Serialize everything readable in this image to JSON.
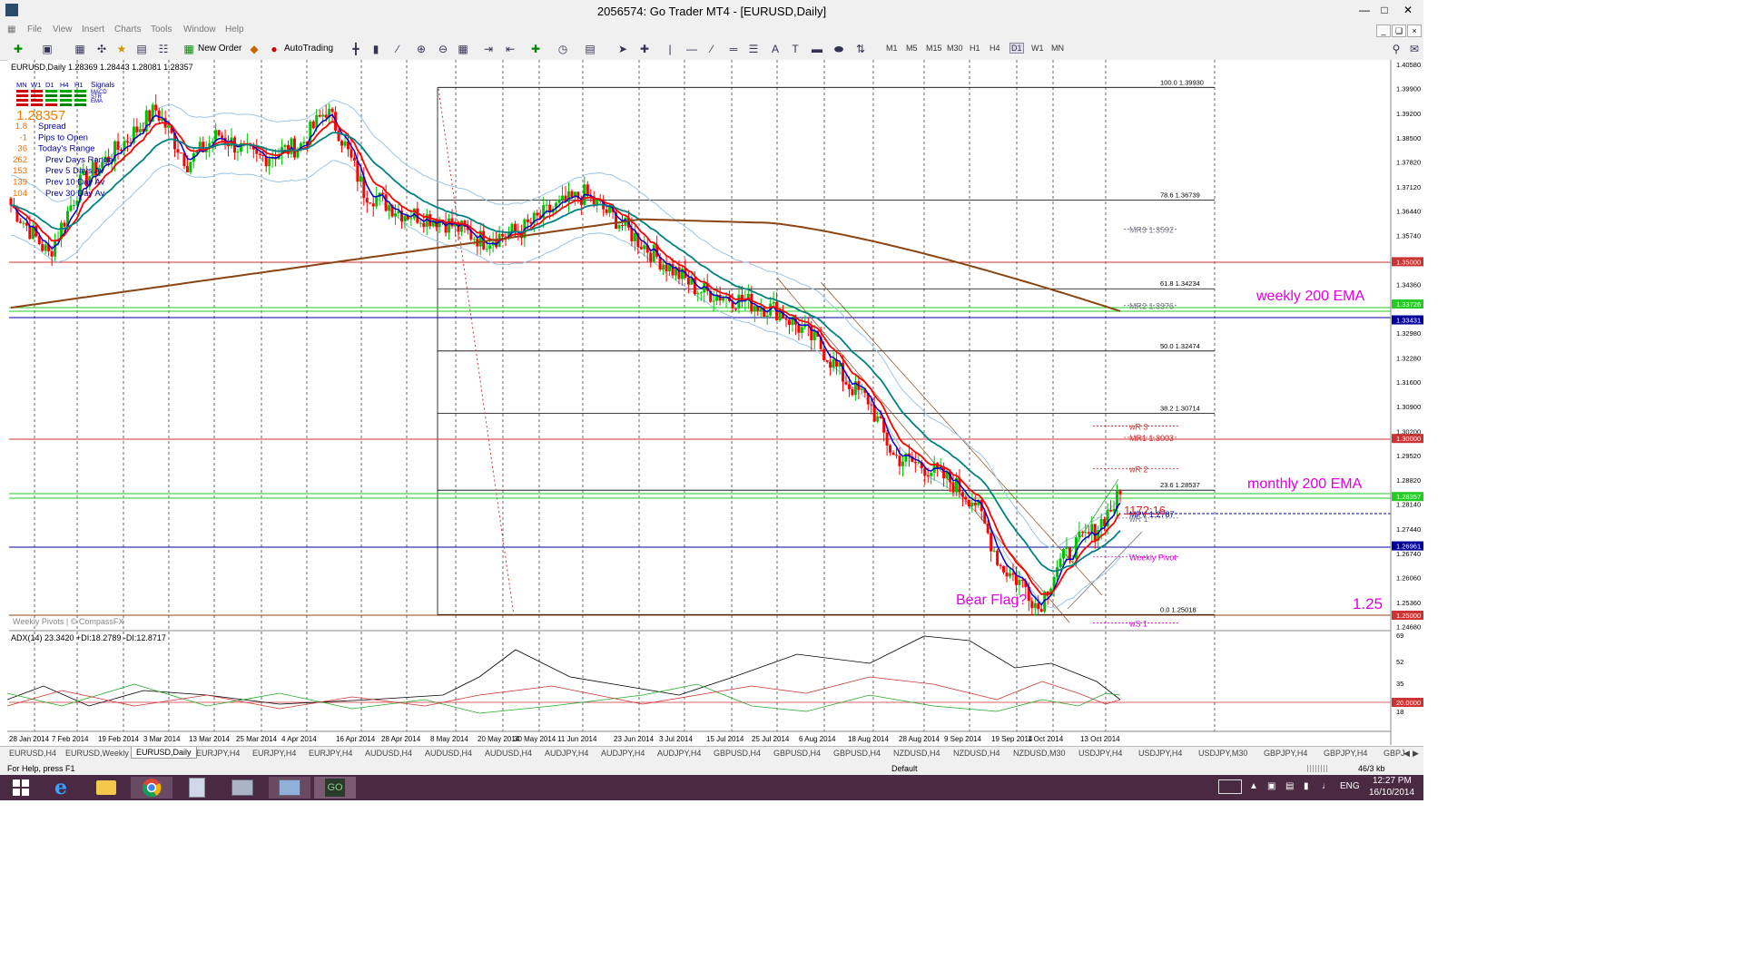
{
  "window": {
    "title": "2056574: Go Trader MT4 - [EURUSD,Daily]"
  },
  "menu": [
    "File",
    "View",
    "Insert",
    "Charts",
    "Tools",
    "Window",
    "Help"
  ],
  "toolbar": {
    "new_order": "New Order",
    "autotrading": "AutoTrading",
    "timeframes": [
      "M1",
      "M5",
      "M15",
      "M30",
      "H1",
      "H4",
      "D1",
      "W1",
      "MN"
    ],
    "active_timeframe": "D1"
  },
  "chart": {
    "header": "EURUSD,Daily  1.28369 1.28443 1.28081 1.28357",
    "signals": {
      "timeframes": [
        "MN",
        "W1",
        "D1",
        "H4",
        "H1"
      ],
      "label": "Signals",
      "rows": [
        "MACD",
        "STR",
        "EMA"
      ]
    },
    "price": "1.28357",
    "info": [
      {
        "value": "1.8",
        "label": "Spread"
      },
      {
        "value": "-1",
        "label": "Pips to Open"
      },
      {
        "value": "36",
        "label": "Today's Range"
      },
      {
        "value": "262",
        "label": "Prev Days Range"
      },
      {
        "value": "153",
        "label": "Prev 5 Days Av"
      },
      {
        "value": "139",
        "label": "Prev 10 Day Av"
      },
      {
        "value": "104",
        "label": "Prev 30 Day Av"
      }
    ],
    "fib": [
      {
        "label": "100.0  1.39930",
        "price": 1.3993
      },
      {
        "label": "78.6  1.36739",
        "price": 1.36739
      },
      {
        "label": "61.8  1.34234",
        "price": 1.34234
      },
      {
        "label": "50.0  1.32474",
        "price": 1.32474
      },
      {
        "label": "38.2  1.30714",
        "price": 1.30714
      },
      {
        "label": "23.6  1.28537",
        "price": 1.28537
      },
      {
        "label": "0.0  1.25018",
        "price": 1.25018
      }
    ],
    "pivots": [
      {
        "label": "MR3  1.3592",
        "price": 1.3592
      },
      {
        "label": "MR2  1.3376",
        "price": 1.3376
      },
      {
        "label": "wR 3",
        "price": 1.3035
      },
      {
        "label": "MR1  1.3003",
        "price": 1.3003
      },
      {
        "label": "wR 2",
        "price": 1.2915
      },
      {
        "label": "MPV  1.2787",
        "price": 1.2787
      },
      {
        "label": "wR 1",
        "price": 1.2775
      },
      {
        "label": "Weekly Pivot",
        "price": 1.2665
      },
      {
        "label": "wS 1",
        "price": 1.2478
      }
    ],
    "timer": "1172:16",
    "annotations": {
      "weekly_ema": "weekly 200 EMA",
      "monthly_ema": "monthly 200 EMA",
      "bear_flag": "Bear Flag?",
      "level_125": "1.25"
    },
    "watermark": "Weekly Pivots | © CompassFX",
    "price_axis": [
      "1.40580",
      "1.39900",
      "1.39200",
      "1.38500",
      "1.37820",
      "1.37120",
      "1.36440",
      "1.35740",
      "1.35000",
      "1.34360",
      "1.33726",
      "1.33431",
      "1.32980",
      "1.32280",
      "1.31600",
      "1.30900",
      "1.30200",
      "1.30000",
      "1.29520",
      "1.28820",
      "1.28357",
      "1.28140",
      "1.27440",
      "1.26961",
      "1.26740",
      "1.26060",
      "1.25360",
      "1.25000",
      "1.24680"
    ],
    "date_axis": [
      "28 Jan 2014",
      "7 Feb 2014",
      "19 Feb 2014",
      "3 Mar 2014",
      "13 Mar 2014",
      "25 Mar 2014",
      "4 Apr 2014",
      "16 Apr 2014",
      "28 Apr 2014",
      "8 May 2014",
      "20 May 2014",
      "30 May 2014",
      "11 Jun 2014",
      "23 Jun 2014",
      "3 Jul 2014",
      "15 Jul 2014",
      "25 Jul 2014",
      "6 Aug 2014",
      "18 Aug 2014",
      "28 Aug 2014",
      "9 Sep 2014",
      "19 Sep 2014",
      "1 Oct 2014",
      "13 Oct 2014"
    ],
    "adx": {
      "header": "ADX(14) 23.3420 +DI:18.2789 -DI:12.8717",
      "axis": [
        "69",
        "52",
        "35",
        "20.0000",
        "18"
      ]
    },
    "colors": {
      "bull": "#00c000",
      "bear": "#ff0000",
      "ema_fast": "#0000cc",
      "ema_red": "#ff0000",
      "ema_teal": "#008080",
      "ema200": "#8b4513",
      "annotation": "#e000e0"
    }
  },
  "tabs": [
    "EURUSD,H4",
    "EURUSD,Weekly",
    "EURUSD,Daily",
    "EURJPY,H4",
    "EURJPY,H4",
    "EURJPY,H4",
    "AUDUSD,H4",
    "AUDUSD,H4",
    "AUDUSD,H4",
    "AUDJPY,H4",
    "AUDJPY,H4",
    "AUDJPY,H4",
    "GBPUSD,H4",
    "GBPUSD,H4",
    "GBPUSD,H4",
    "NZDUSD,H4",
    "NZDUSD,H4",
    "NZDUSD,M30",
    "USDJPY,H4",
    "USDJPY,H4",
    "USDJPY,M30",
    "GBPJPY,H4",
    "GBPJPY,H4",
    "GBPJ"
  ],
  "active_tab": "EURUSD,Daily",
  "status": {
    "help": "For Help, press F1",
    "profile": "Default",
    "traffic": "46/3 kb"
  },
  "taskbar": {
    "lang": "ENG",
    "time": "12:27 PM",
    "date": "16/10/2014"
  }
}
